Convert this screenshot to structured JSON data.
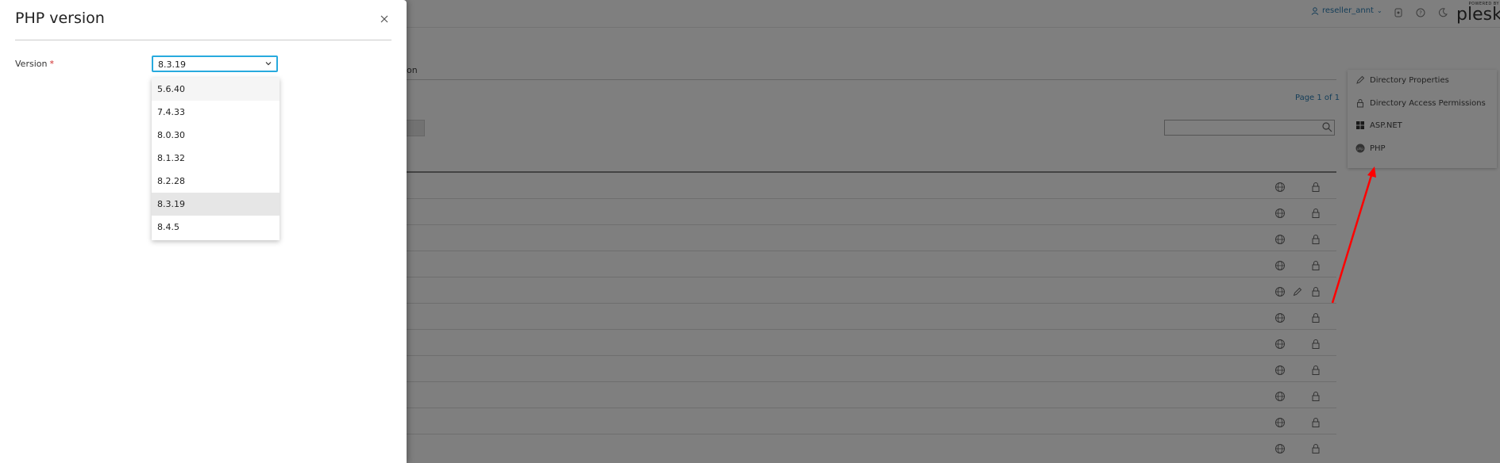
{
  "topbar": {
    "user_label": "reseller_annt",
    "brand_powered": "POWERED BY",
    "brand_name": "plesk"
  },
  "background": {
    "tab_fragment": "ion",
    "pagination": "Page 1 of 1",
    "button_fragment": "e",
    "search_placeholder": ""
  },
  "context_menu": {
    "items": [
      {
        "label": "Directory Properties",
        "icon": "pencil-icon"
      },
      {
        "label": "Directory Access Permissions",
        "icon": "lock-icon"
      },
      {
        "label": "ASP.NET",
        "icon": "windows-icon"
      },
      {
        "label": "PHP",
        "icon": "php-icon"
      }
    ]
  },
  "modal": {
    "title": "PHP version",
    "field_label": "Version",
    "required_mark": "*",
    "selected_value": "8.3.19",
    "options": [
      {
        "label": "5.6.40",
        "state": "hover"
      },
      {
        "label": "7.4.33",
        "state": ""
      },
      {
        "label": "8.0.30",
        "state": ""
      },
      {
        "label": "8.1.32",
        "state": ""
      },
      {
        "label": "8.2.28",
        "state": ""
      },
      {
        "label": "8.3.19",
        "state": "selected"
      },
      {
        "label": "8.4.5",
        "state": ""
      }
    ]
  },
  "colors": {
    "accent": "#28aade",
    "link": "#2a7db3",
    "required": "#d02a2a",
    "annotation_arrow": "#ff0000"
  }
}
